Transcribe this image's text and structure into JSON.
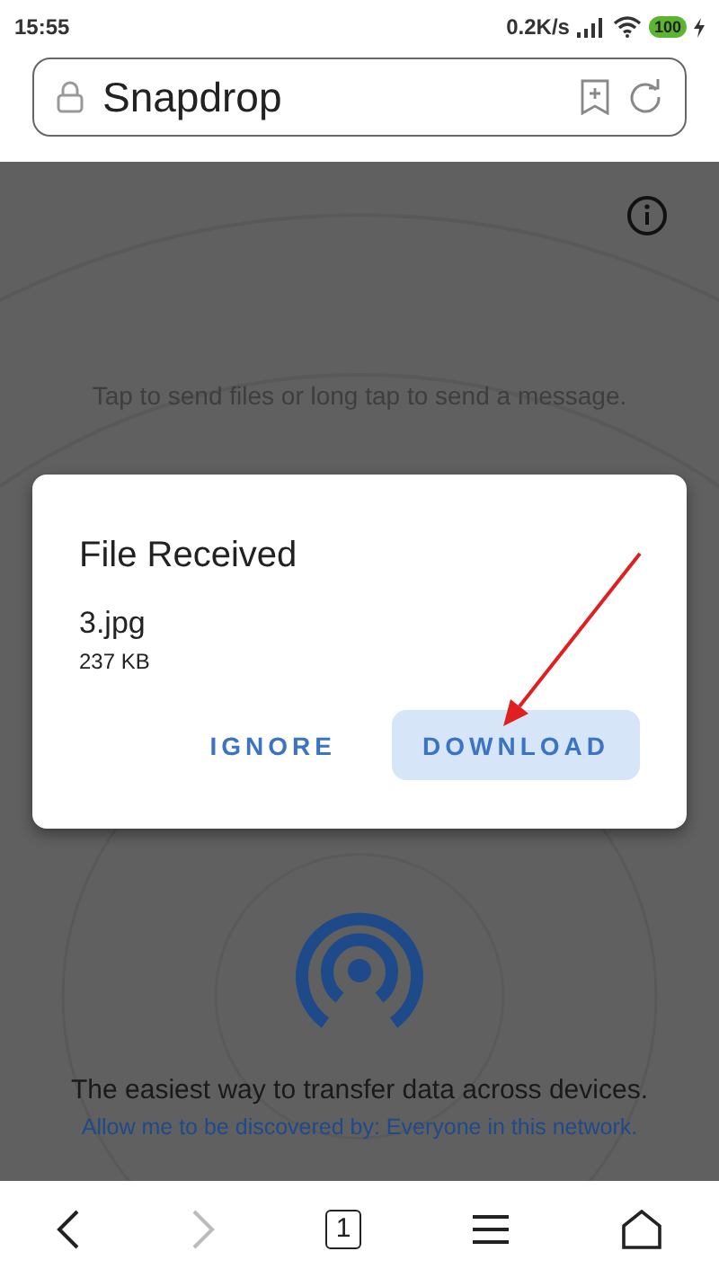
{
  "status_bar": {
    "time": "15:55",
    "speed": "0.2K/s",
    "battery": "100"
  },
  "address_bar": {
    "title": "Snapdrop"
  },
  "page": {
    "hint": "Tap to send files or long tap to send a message.",
    "tagline": "The easiest way to transfer data across devices.",
    "discovery": "Allow me to be discovered by: Everyone in this network."
  },
  "dialog": {
    "title": "File Received",
    "file_name": "3.jpg",
    "file_size": "237 KB",
    "buttons": [
      {
        "label": "IGNORE",
        "kind": "text"
      },
      {
        "label": "DOWNLOAD",
        "kind": "filled"
      }
    ]
  },
  "bottom_nav": [
    {
      "kind": "back",
      "disabled": false
    },
    {
      "kind": "forward",
      "disabled": true
    },
    {
      "kind": "tabs",
      "label": "1",
      "disabled": false
    },
    {
      "kind": "menu",
      "disabled": false
    },
    {
      "kind": "home",
      "disabled": false
    }
  ]
}
